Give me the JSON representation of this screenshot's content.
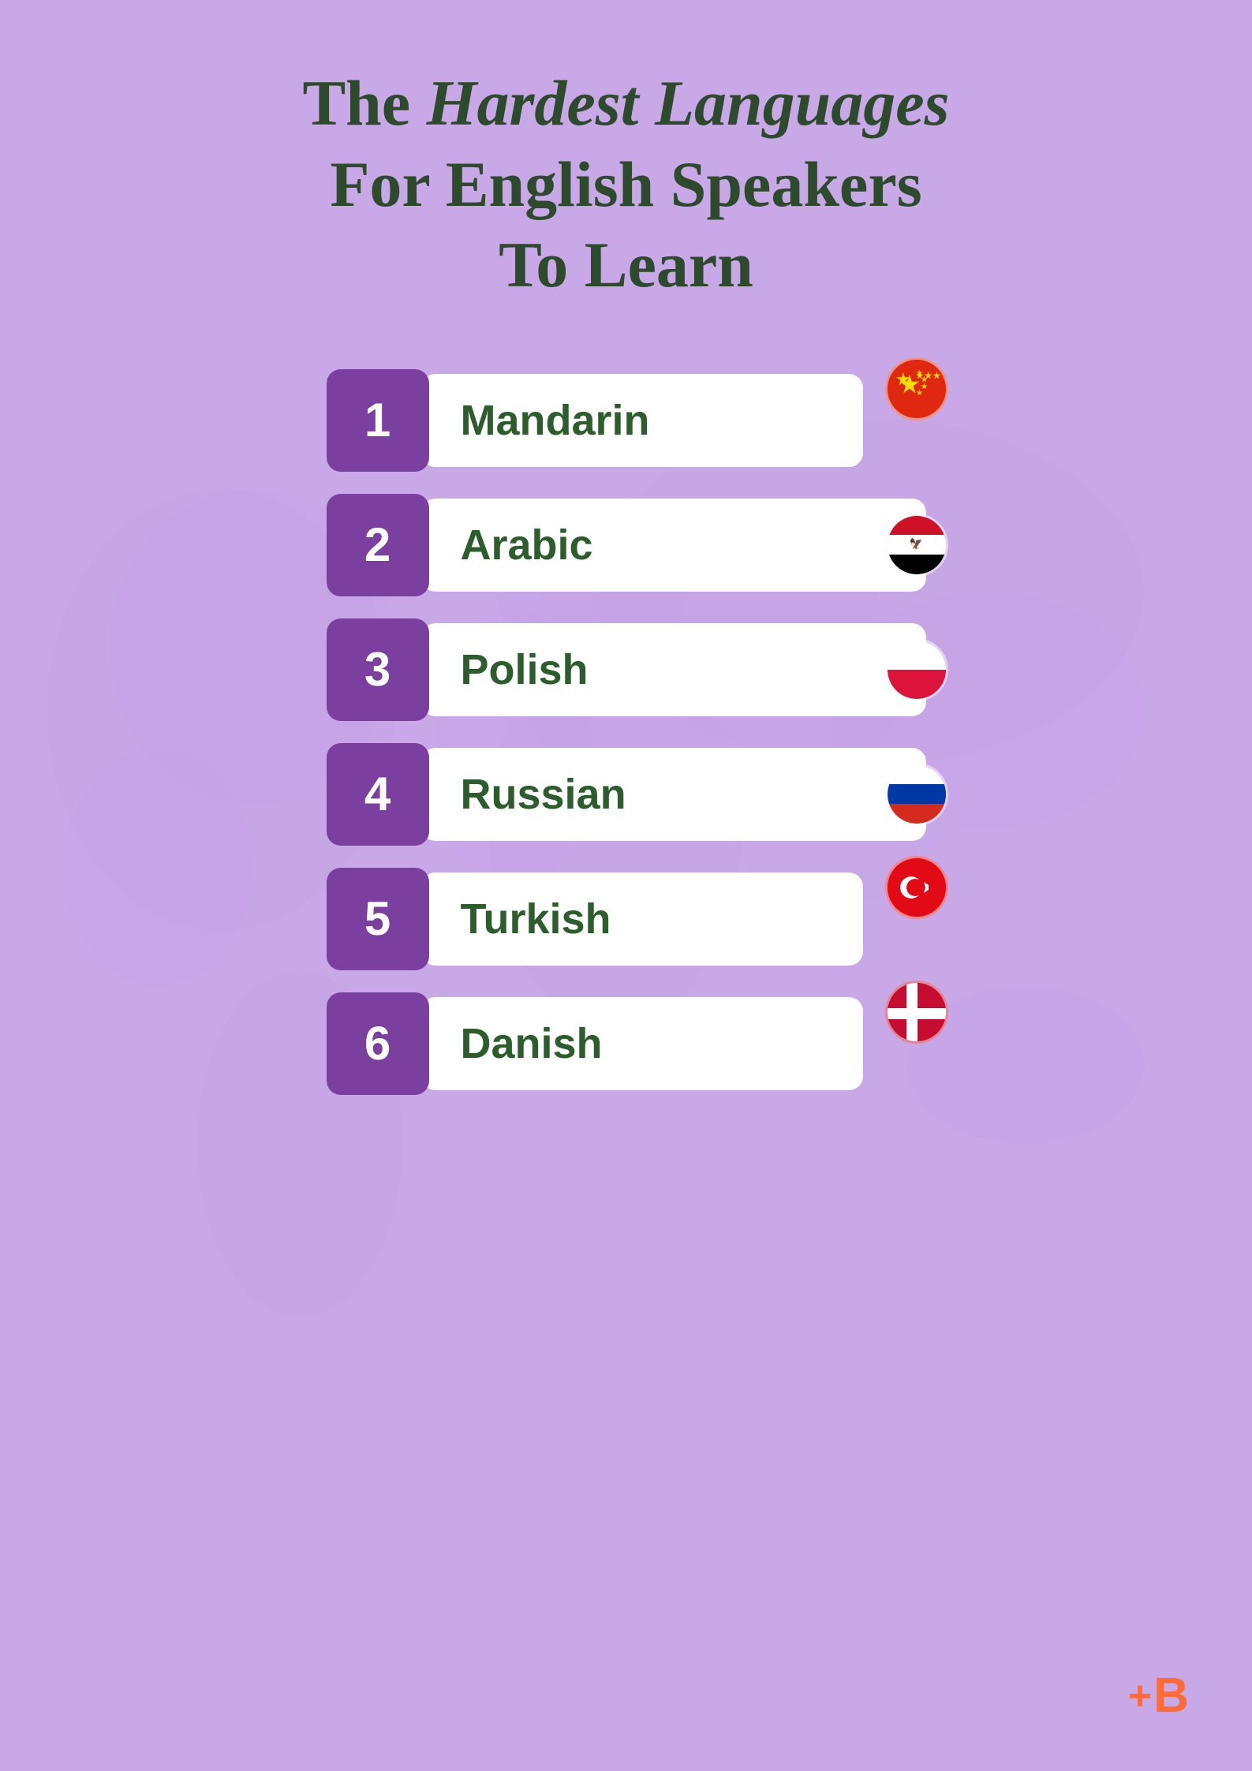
{
  "page": {
    "title_line1": "The ",
    "title_italic": "Hardest Languages",
    "title_line2": "For English Speakers",
    "title_line3": "To Learn",
    "background_color": "#c9a8e8",
    "brand": "+B"
  },
  "languages": [
    {
      "rank": "1",
      "name": "Mandarin",
      "flag_type": "china"
    },
    {
      "rank": "2",
      "name": "Arabic",
      "flag_type": "egypt"
    },
    {
      "rank": "3",
      "name": "Polish",
      "flag_type": "poland"
    },
    {
      "rank": "4",
      "name": "Russian",
      "flag_type": "russia"
    },
    {
      "rank": "5",
      "name": "Turkish",
      "flag_type": "turkey"
    },
    {
      "rank": "6",
      "name": "Danish",
      "flag_type": "denmark"
    }
  ]
}
